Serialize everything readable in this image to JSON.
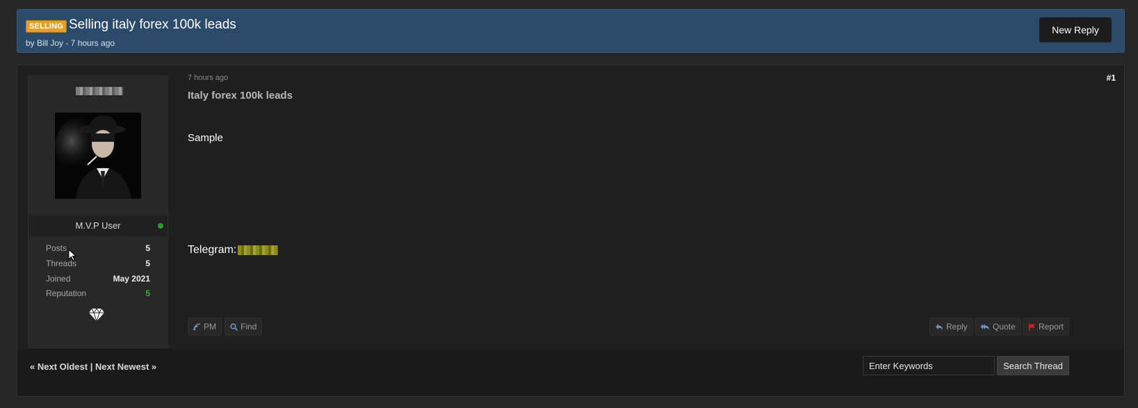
{
  "thread": {
    "badge": "SELLING",
    "title": "Selling italy forex 100k leads",
    "meta": "by Bill Joy - 7 hours ago",
    "new_reply_label": "New Reply"
  },
  "user": {
    "rank": "M.V.P User",
    "online": true,
    "stats": [
      {
        "label": "Posts",
        "value": "5"
      },
      {
        "label": "Threads",
        "value": "5"
      },
      {
        "label": "Joined",
        "value": "May 2021"
      },
      {
        "label": "Reputation",
        "value": "5"
      }
    ],
    "award_icon": "diamond-icon"
  },
  "post": {
    "date": "7 hours ago",
    "number": "#1",
    "subject": "Italy forex 100k leads",
    "body_line1": "Sample",
    "telegram_label": "Telegram:"
  },
  "actions": {
    "pm": "PM",
    "find": "Find",
    "reply": "Reply",
    "quote": "Quote",
    "report": "Report"
  },
  "footer": {
    "next_oldest": "« Next Oldest",
    "separator": " | ",
    "next_newest": "Next Newest »",
    "search_value": "Enter Keywords",
    "search_button": "Search Thread"
  },
  "colors": {
    "header_bg": "#2c4a6a",
    "badge": "#e0a226",
    "online": "#2e9a2e",
    "reputation": "#2eb82e",
    "report_flag": "#cc2222",
    "action_icon": "#6f93c4"
  }
}
